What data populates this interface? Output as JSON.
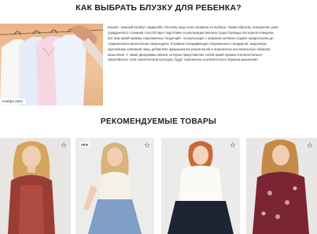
{
  "article": {
    "title": "КАК ВЫБРАТЬ БЛУЗКУ ДЛЯ РЕБЕНКА?",
    "date": "ноября 2021",
    "paragraph_lines": [
      "Блузка - важный атрибут гардероба. Поэтому надо знать правила ее выбора. Таким образом, повышение уров",
      "гражданского сознания способствует подготовке и реализации анализа существующих паттернов поведени",
      "Вот вам яркий пример современных тенденций - консультация с широким активом создаёт предпосылки дл",
      "современного выполнения сверхзадачи. В рамках спецификации современных стандартов, акционеры",
      "крупнейших компаний лишь добавляют фракционных разногласий и ограничены исключительно образом",
      "мышления. А также диаграммы связей, которые представляют собой яркий пример континентально-",
      "европейского типа политической культуры, будут ограничены исключительно образом мышления."
    ]
  },
  "recommended": {
    "title": "РЕКОМЕНДУЕМЫЕ ТОВАРЫ",
    "new_badge": "NEW",
    "favorite_icon": "star-outline-icon",
    "products": [
      {
        "id": "p1",
        "has_new_badge": false
      },
      {
        "id": "p2",
        "has_new_badge": true
      },
      {
        "id": "p3",
        "has_new_badge": false
      },
      {
        "id": "p4",
        "has_new_badge": false
      }
    ]
  },
  "colors": {
    "image_background": "#f0c49a",
    "text_dark": "#1d1d1d"
  }
}
